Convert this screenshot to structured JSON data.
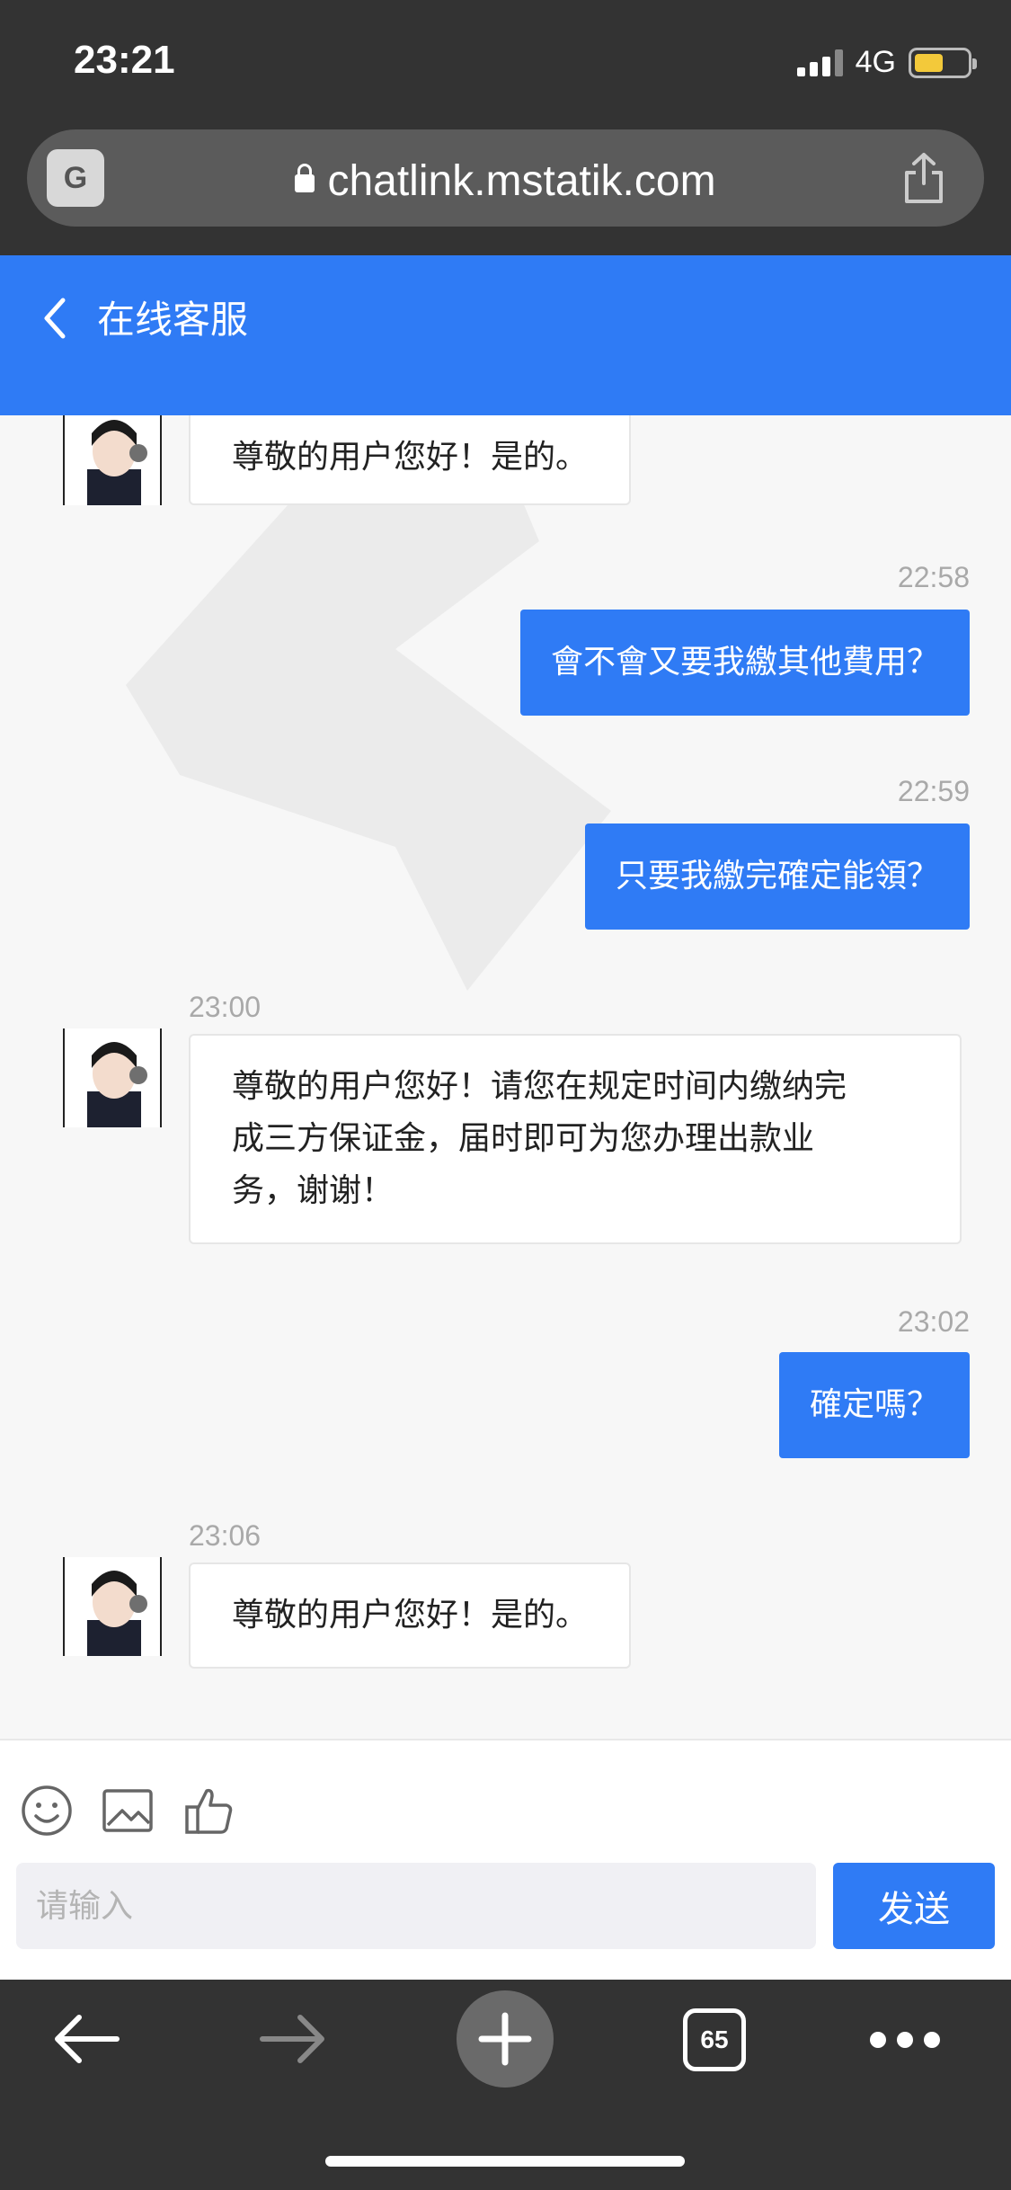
{
  "status_bar": {
    "time": "23:21",
    "network": "4G",
    "battery_level": 0.55
  },
  "browser": {
    "url": "chatlink.mstatik.com",
    "translate_icon": "translate-icon",
    "tabs_count": "65"
  },
  "header": {
    "title": "在线客服"
  },
  "messages": [
    {
      "side": "left",
      "time": "",
      "text": "尊敬的用户您好！是的。"
    },
    {
      "side": "right",
      "time": "22:58",
      "text": "會不會又要我繳其他費用？"
    },
    {
      "side": "right",
      "time": "22:59",
      "text": "只要我繳完確定能領？"
    },
    {
      "side": "left",
      "time": "23:00",
      "lines": [
        "尊敬的用户您好！请您在规定时间内缴纳完",
        "成三方保证金，届时即可为您办理出款业",
        "务，谢谢！"
      ]
    },
    {
      "side": "right",
      "time": "23:02",
      "text": "確定嗎？"
    },
    {
      "side": "left",
      "time": "23:06",
      "text": "尊敬的用户您好！是的。"
    }
  ],
  "input": {
    "placeholder": "请输入",
    "send_label": "发送"
  },
  "colors": {
    "accent": "#2f7bf5",
    "chrome": "#333333",
    "chat_bg": "#f7f7f7"
  }
}
